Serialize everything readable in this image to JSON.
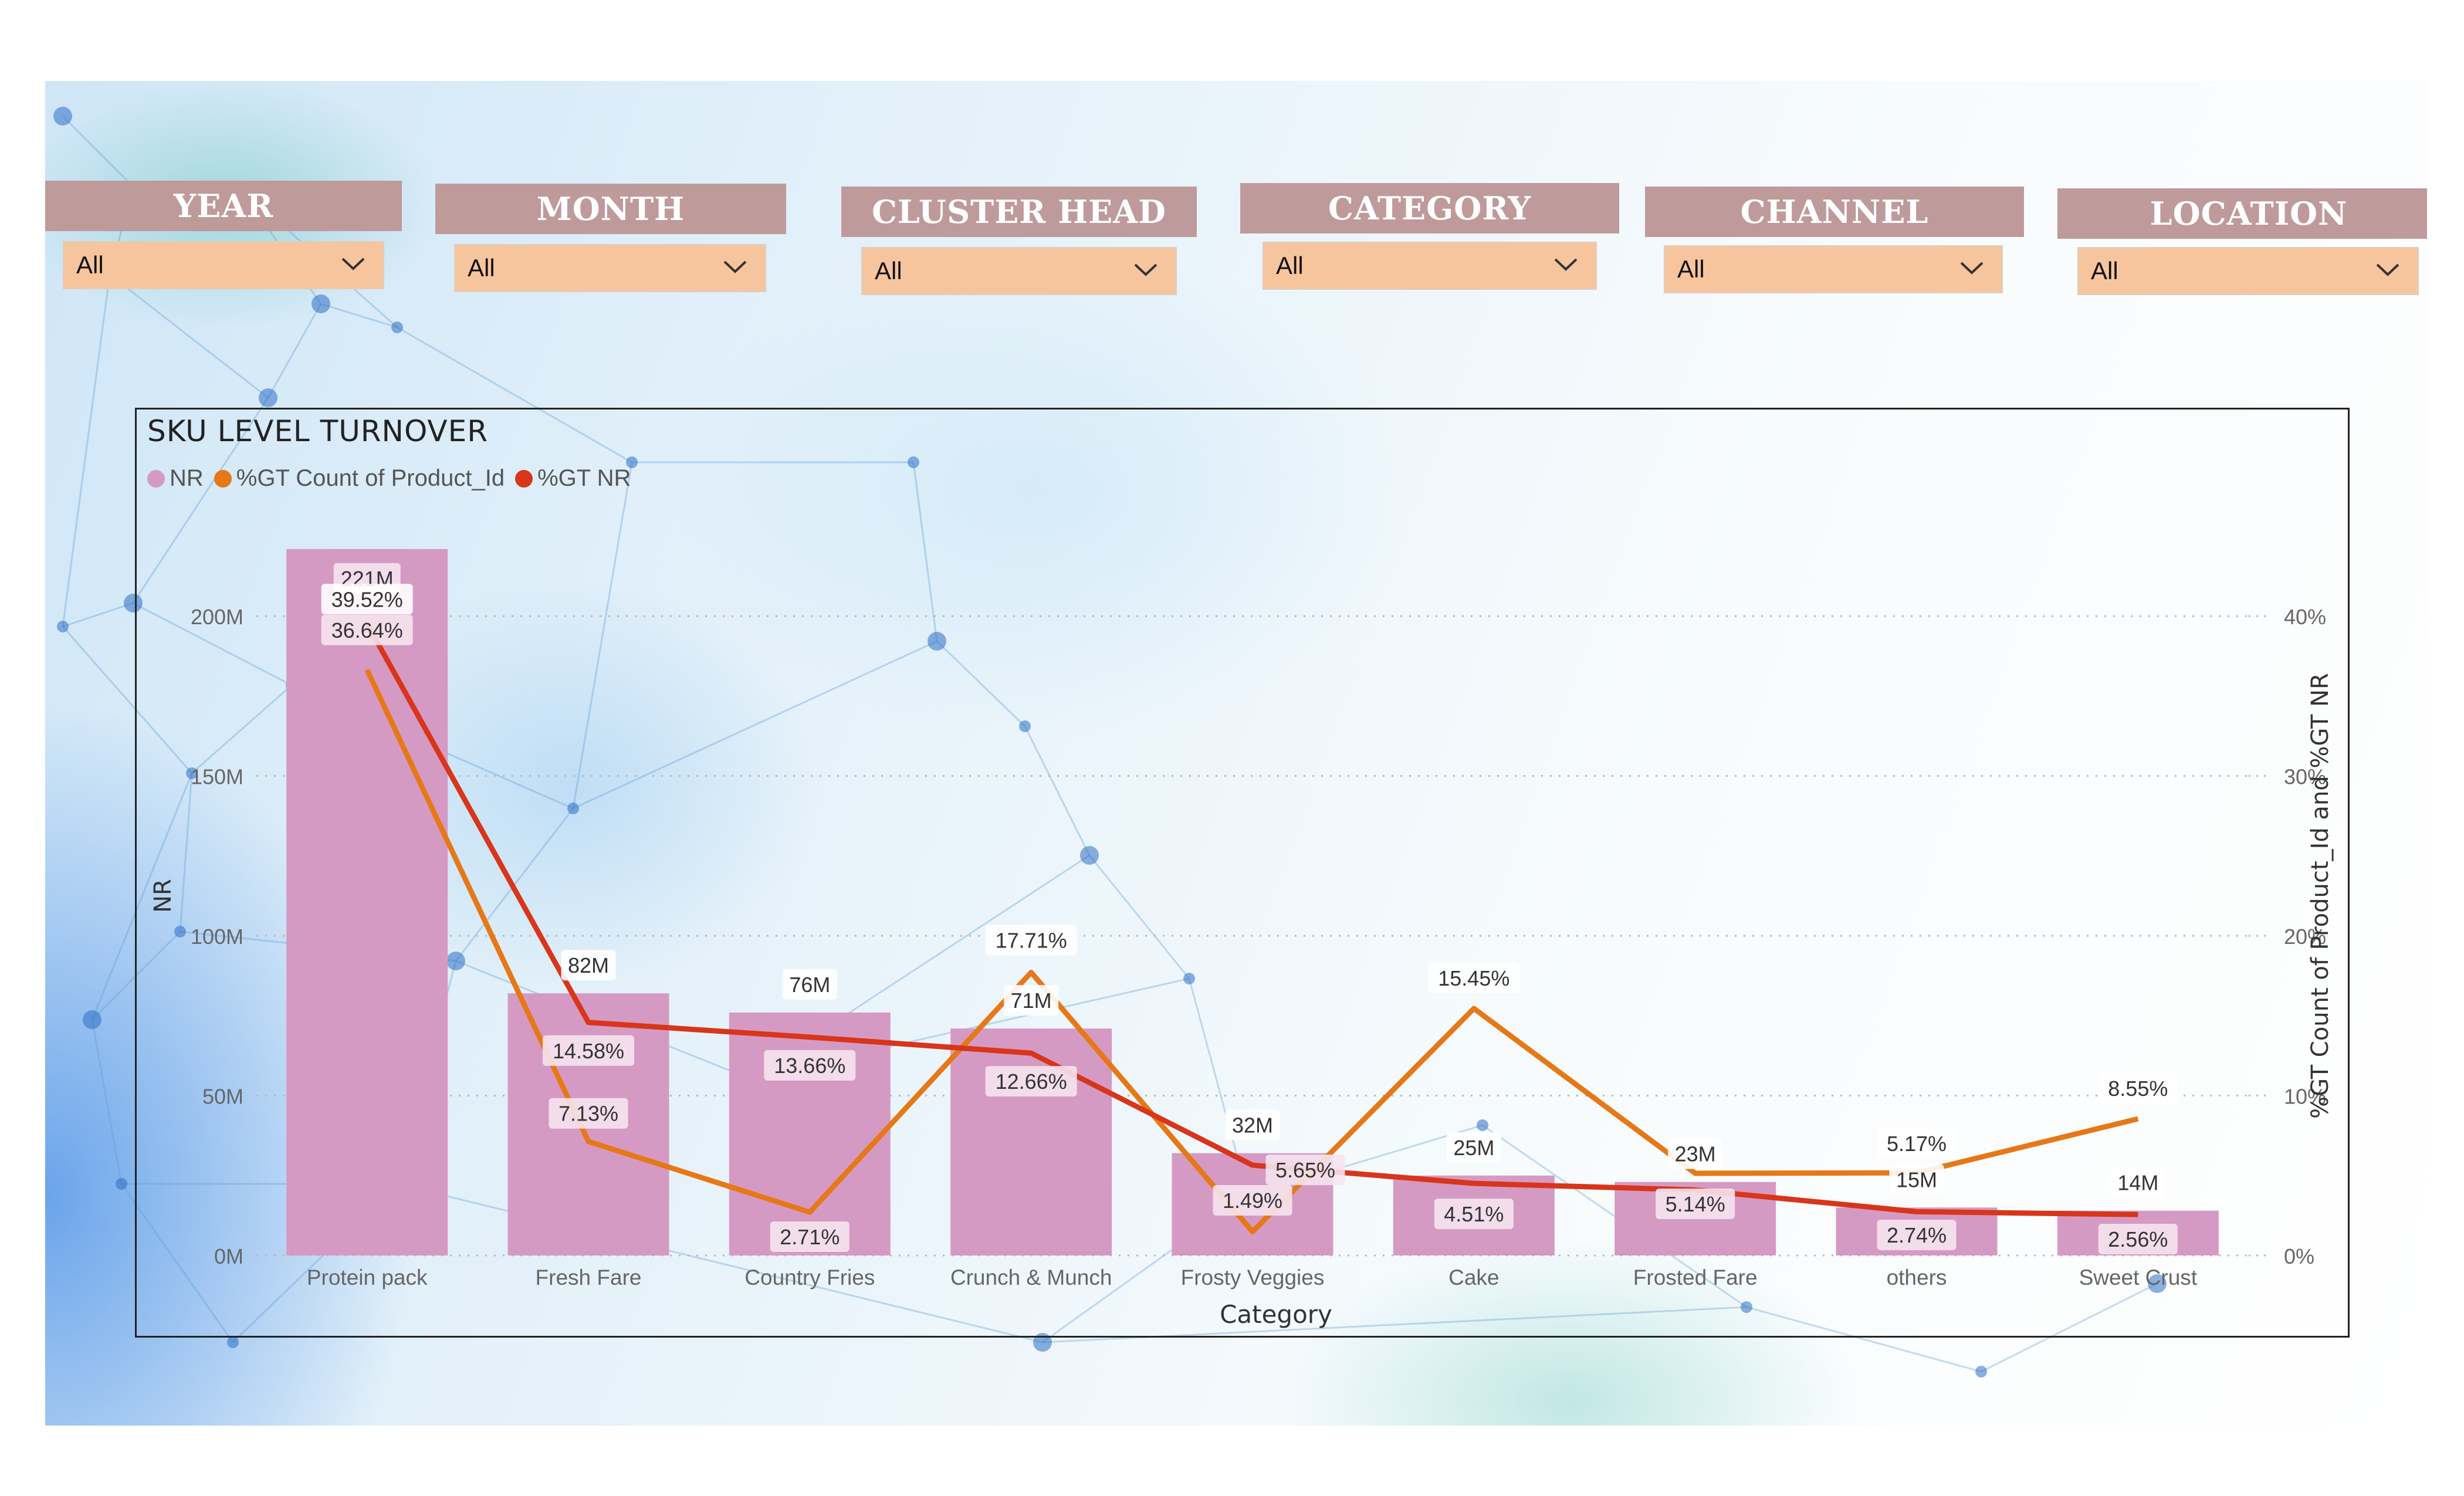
{
  "slicers": [
    {
      "label": "YEAR",
      "value": "All"
    },
    {
      "label": "MONTH",
      "value": "All"
    },
    {
      "label": "CLUSTER HEAD",
      "value": "All"
    },
    {
      "label": "CATEGORY",
      "value": "All"
    },
    {
      "label": "CHANNEL",
      "value": "All"
    },
    {
      "label": "LOCATION",
      "value": "All"
    }
  ],
  "icons": {
    "dropdown": "chevron-down-icon",
    "legend": "circle-icon"
  },
  "colors": {
    "slicer_header": "#bf9a9b",
    "slicer_dropdown": "#f7c59d",
    "bar": "#d59ac4",
    "count_line": "#e67817",
    "nr_line": "#d8351a"
  },
  "chart_data": {
    "type": "bar",
    "title": "SKU LEVEL TURNOVER",
    "xlabel": "Category",
    "ylabel": "NR",
    "y2label": "%GT Count of Product_Id and %GT NR",
    "categories": [
      "Protein pack",
      "Fresh Fare",
      "Country Fries",
      "Crunch & Munch",
      "Frosty Veggies",
      "Cake",
      "Frosted Fare",
      "others",
      "Sweet Crust"
    ],
    "ylim": [
      0,
      225
    ],
    "yticks": [
      "0M",
      "50M",
      "100M",
      "150M",
      "200M"
    ],
    "y2lim": [
      0,
      45
    ],
    "y2ticks": [
      "0%",
      "10%",
      "20%",
      "30%",
      "40%"
    ],
    "grid": true,
    "legend_position": "top-left",
    "series": [
      {
        "name": "NR",
        "kind": "bar",
        "unit": "M",
        "values": [
          221,
          82,
          76,
          71,
          32,
          25,
          23,
          15,
          14
        ],
        "labels": [
          "221M",
          "82M",
          "76M",
          "71M",
          "32M",
          "25M",
          "23M",
          "15M",
          "14M"
        ]
      },
      {
        "name": "%GT Count of Product_Id",
        "kind": "line",
        "axis": "right",
        "values": [
          36.64,
          7.13,
          2.71,
          17.71,
          1.49,
          15.45,
          5.14,
          5.17,
          8.55
        ],
        "labels": [
          "36.64%",
          "7.13%",
          "2.71%",
          "17.71%",
          "1.49%",
          "15.45%",
          "5.14%",
          "5.17%",
          "8.55%"
        ]
      },
      {
        "name": "%GT NR",
        "kind": "line",
        "axis": "right",
        "values": [
          39.52,
          14.58,
          13.66,
          12.66,
          5.65,
          4.51,
          4.1,
          2.74,
          2.56
        ],
        "labels": [
          "39.52%",
          "14.58%",
          "13.66%",
          "12.66%",
          "5.65%",
          "4.51%",
          "",
          "2.74%",
          "2.56%"
        ]
      }
    ]
  }
}
